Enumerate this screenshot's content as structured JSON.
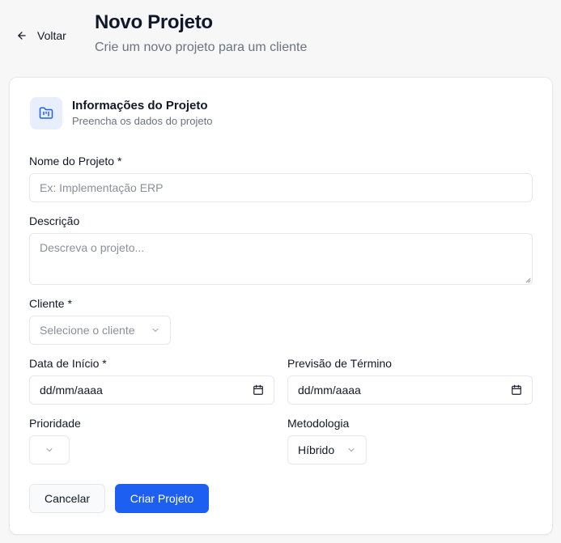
{
  "header": {
    "back_label": "Voltar",
    "title": "Novo Projeto",
    "subtitle": "Crie um novo projeto para um cliente"
  },
  "card": {
    "icon": "folder-kanban-icon",
    "title": "Informações do Projeto",
    "subtitle": "Preencha os dados do projeto"
  },
  "form": {
    "name": {
      "label": "Nome do Projeto *",
      "placeholder": "Ex: Implementação ERP",
      "value": ""
    },
    "description": {
      "label": "Descrição",
      "placeholder": "Descreva o projeto...",
      "value": ""
    },
    "client": {
      "label": "Cliente *",
      "placeholder": "Selecione o cliente"
    },
    "start_date": {
      "label": "Data de Início *",
      "value": "dd/mm/aaaa"
    },
    "end_date": {
      "label": "Previsão de Término",
      "value": "dd/mm/aaaa"
    },
    "priority": {
      "label": "Prioridade",
      "value": ""
    },
    "methodology": {
      "label": "Metodologia",
      "value": "Híbrido"
    }
  },
  "actions": {
    "cancel_label": "Cancelar",
    "create_label": "Criar Projeto"
  },
  "colors": {
    "accent": "#1d5ff0",
    "icon_bg": "#e8eefc",
    "page_bg": "#f7f7f8"
  }
}
